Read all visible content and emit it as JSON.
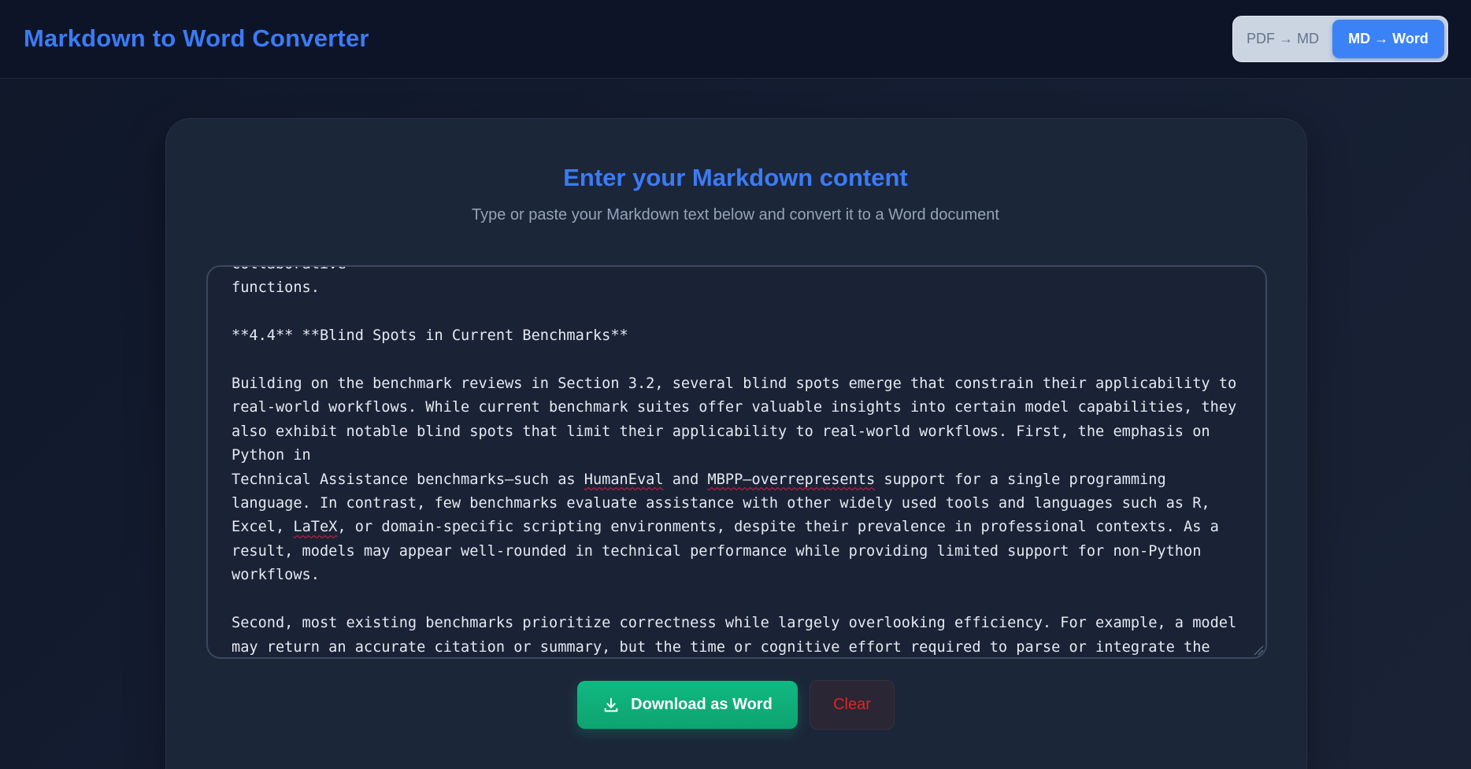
{
  "header": {
    "title": "Markdown to Word Converter",
    "tabs": [
      {
        "label": "PDF → MD",
        "active": false
      },
      {
        "label": "MD → Word",
        "active": true
      }
    ]
  },
  "main": {
    "title": "Enter your Markdown content",
    "subtitle": "Type or paste your Markdown text below and convert it to a Word document"
  },
  "editor": {
    "lines": [
      "collaborative",
      "functions.",
      "",
      "**4.4** **Blind Spots in Current Benchmarks**",
      "",
      "Building on the benchmark reviews in Section 3.2, several blind spots emerge that constrain their applicability to",
      "real-world workflows. While current benchmark suites offer valuable insights into certain model capabilities, they",
      "also exhibit notable blind spots that limit their applicability to real-world workflows. First, the emphasis on",
      "Python in",
      "Technical Assistance benchmarks—such as HumanEval and MBPP—overrepresents support for a single programming",
      "language. In contrast, few benchmarks evaluate assistance with other widely used tools and languages such as R,",
      "Excel, LaTeX, or domain-specific scripting environments, despite their prevalence in professional contexts. As a",
      "result, models may appear well-rounded in technical performance while providing limited support for non-Python",
      "workflows.",
      "",
      "Second, most existing benchmarks prioritize correctness while largely overlooking efficiency. For example, a model",
      "may return an accurate citation or summary, but the time or cognitive effort required to parse or integrate the"
    ]
  },
  "actions": {
    "download_label": "Download as Word",
    "clear_label": "Clear"
  },
  "colors": {
    "accent": "#3b7bf5",
    "download": "#10b981",
    "clear_text": "#dc2626"
  },
  "icons": {
    "download": "download-icon"
  }
}
